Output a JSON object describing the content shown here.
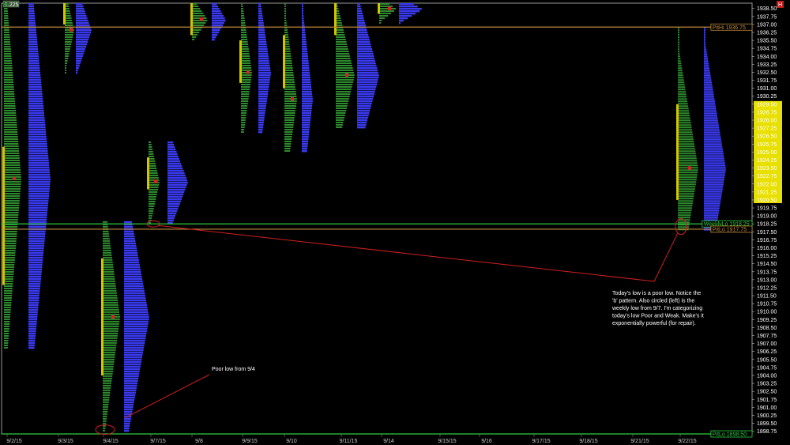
{
  "window": {
    "title": "1.225",
    "close_label": "H"
  },
  "chart_data": {
    "type": "market-profile",
    "ylim": [
      1898.5,
      1939.0
    ],
    "y_tick_step": 0.75,
    "y_tick_start": 1898.75,
    "y_tick_count": 54,
    "highlight_range": [
      1920.5,
      1929.5
    ],
    "highlight_color": "#e8e000",
    "x_labels": [
      "9/2/15",
      "9/3/15",
      "9/4/15",
      "9/7/15",
      "9/8",
      "9/9/15",
      "9/10",
      "9/11/15",
      "9/14",
      "9/15/15",
      "9/16",
      "9/17/15",
      "9/18/15",
      "9/21/15",
      "9/22/15"
    ],
    "levels": [
      {
        "name": "PitHi",
        "label": "PitHi 1936.75",
        "value": 1936.75,
        "color": "#c08a3a"
      },
      {
        "name": "WeeklyLo",
        "label": "WeeklyLo 1918.25",
        "value": 1918.25,
        "color": "#2ecc40"
      },
      {
        "name": "PitLo",
        "label": "PitLo 1917.75",
        "value": 1917.75,
        "color": "#c08a3a"
      },
      {
        "name": "PitLo2",
        "label": "PitLo 1898.50",
        "value": 1898.5,
        "color": "#2ecc40"
      }
    ],
    "series": [
      {
        "name": "tpo",
        "color": "#2e8b2e"
      },
      {
        "name": "volume",
        "color": "#3a3af0"
      },
      {
        "name": "value-area",
        "color": "#d4c400"
      }
    ],
    "sessions": [
      {
        "date": "9/2/15",
        "low": 1906.5,
        "high": 1939.0,
        "poc": 1922.5,
        "va": [
          1912.5,
          1925.5
        ]
      },
      {
        "date": "9/3/15",
        "low": 1932.5,
        "high": 1939.0,
        "poc": 1936.5,
        "va": [
          1937.0,
          1939.0
        ]
      },
      {
        "date": "9/4/15",
        "low": 1898.75,
        "high": 1918.5,
        "poc": 1909.5,
        "va": [
          1904.0,
          1915.0
        ]
      },
      {
        "date": "9/7/15",
        "low": 1918.25,
        "high": 1926.0,
        "poc": 1922.25,
        "va": [
          1921.5,
          1924.5
        ]
      },
      {
        "date": "9/8",
        "low": 1935.5,
        "high": 1939.0,
        "poc": 1937.5,
        "va": [
          1936.0,
          1939.0
        ]
      },
      {
        "date": "9/9/15",
        "low": 1926.75,
        "high": 1939.0,
        "poc": 1932.5,
        "va": [
          1931.5,
          1935.5
        ]
      },
      {
        "date": "9/10",
        "low": 1925.0,
        "high": 1939.0,
        "poc": 1930.0,
        "va": [
          1931.0,
          1936.0
        ]
      },
      {
        "date": "9/11/15",
        "low": 1927.25,
        "high": 1939.0,
        "poc": 1932.25,
        "va": [
          1936.0,
          1939.0
        ]
      },
      {
        "date": "9/14",
        "low": 1937.0,
        "high": 1939.0,
        "poc": 1938.5,
        "va": [
          1938.0,
          1939.0
        ]
      },
      {
        "date": "9/22/15",
        "low": 1917.75,
        "high": 1936.75,
        "poc": 1923.5,
        "va": [
          1920.5,
          1929.5
        ]
      }
    ],
    "annotations": [
      {
        "text": [
          "Today's low is a poor low. Notice the",
          "'b' pattern. Also circled (left) is the",
          "weekly low from 9/7. I'm categorizing",
          "today's low Poor and Weak. Make's it",
          "exponentially powerful (for repair)."
        ]
      },
      {
        "text": [
          "Poor low from 9/4"
        ]
      }
    ]
  }
}
